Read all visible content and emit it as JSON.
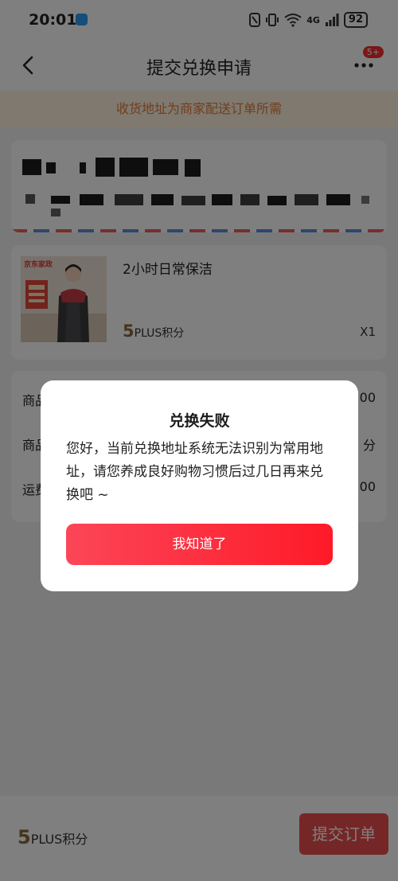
{
  "status_bar": {
    "time": "20:01",
    "network": "4G",
    "battery": "92"
  },
  "header": {
    "title": "提交兑换申请",
    "badge": "5+"
  },
  "notice": {
    "text": "收货地址为商家配送订单所需"
  },
  "product": {
    "name": "2小时日常保洁",
    "points_value": "5",
    "points_unit": "PLUS积分",
    "quantity": "X1",
    "image_brand": "京东家政"
  },
  "summary": {
    "rows": [
      {
        "label": "商品",
        "value": "00"
      },
      {
        "label": "商品",
        "value": "分"
      },
      {
        "label": "运费",
        "value": "00"
      }
    ]
  },
  "bottom_bar": {
    "points_value": "5",
    "points_unit": "PLUS积分",
    "submit_label": "提交订单"
  },
  "dialog": {
    "title": "兑换失败",
    "message": "您好，当前兑换地址系统无法识别为常用地址，请您养成良好购物习惯后过几日再来兑换吧 ~",
    "button_label": "我知道了"
  }
}
